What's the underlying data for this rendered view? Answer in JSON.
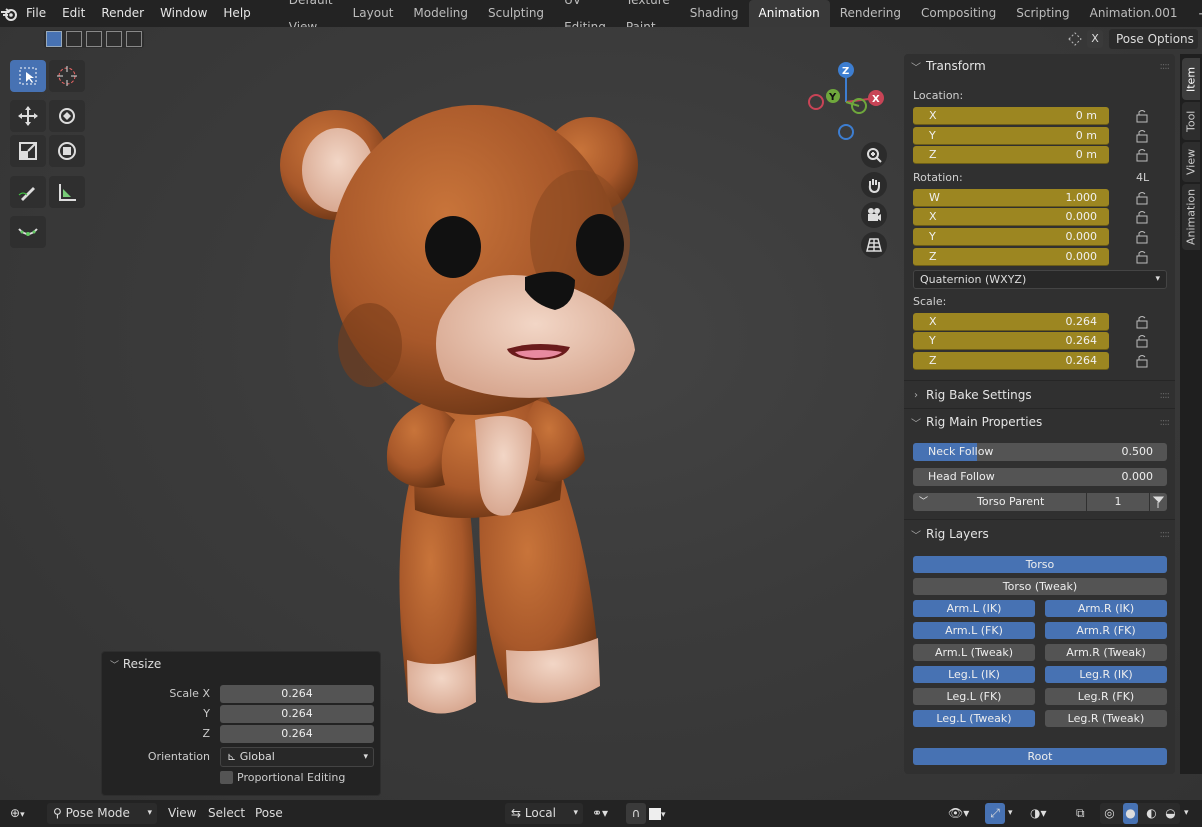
{
  "menu": {
    "items": [
      "File",
      "Edit",
      "Render",
      "Window",
      "Help"
    ]
  },
  "workspaces": {
    "tabs": [
      "Default View",
      "Layout",
      "Modeling",
      "Sculpting",
      "UV Editing",
      "Texture Paint",
      "Shading",
      "Animation",
      "Rendering",
      "Compositing",
      "Scripting",
      "Animation.001"
    ],
    "active": "Animation"
  },
  "header_right": {
    "x_label": "X",
    "pose_options": "Pose Options"
  },
  "gizmo": {
    "z": "Z",
    "y": "Y",
    "x": "X"
  },
  "npanel": {
    "transform": {
      "title": "Transform",
      "location_label": "Location:",
      "location": [
        {
          "axis": "X",
          "value": "0 m"
        },
        {
          "axis": "Y",
          "value": "0 m"
        },
        {
          "axis": "Z",
          "value": "0 m"
        }
      ],
      "rotation_label": "Rotation:",
      "rotation_4l": "4L",
      "rotation": [
        {
          "axis": "W",
          "value": "1.000"
        },
        {
          "axis": "X",
          "value": "0.000"
        },
        {
          "axis": "Y",
          "value": "0.000"
        },
        {
          "axis": "Z",
          "value": "0.000"
        }
      ],
      "rotation_mode": "Quaternion (WXYZ)",
      "scale_label": "Scale:",
      "scale": [
        {
          "axis": "X",
          "value": "0.264"
        },
        {
          "axis": "Y",
          "value": "0.264"
        },
        {
          "axis": "Z",
          "value": "0.264"
        }
      ]
    },
    "rig_bake": {
      "title": "Rig Bake Settings"
    },
    "rig_main": {
      "title": "Rig Main Properties",
      "neck_follow": {
        "label": "Neck Follow",
        "value": "0.500",
        "fraction": 0.5
      },
      "head_follow": {
        "label": "Head Follow",
        "value": "0.000",
        "fraction": 0
      },
      "torso_parent": {
        "label": "Torso Parent",
        "value": "1"
      }
    },
    "rig_layers": {
      "title": "Rig Layers",
      "torso": "Torso",
      "torso_tweak": "Torso (Tweak)",
      "rows": [
        [
          {
            "label": "Arm.L (IK)",
            "on": true
          },
          {
            "label": "Arm.R (IK)",
            "on": true
          }
        ],
        [
          {
            "label": "Arm.L (FK)",
            "on": true
          },
          {
            "label": "Arm.R (FK)",
            "on": true
          }
        ],
        [
          {
            "label": "Arm.L (Tweak)",
            "on": false
          },
          {
            "label": "Arm.R (Tweak)",
            "on": false
          }
        ],
        [
          {
            "label": "Leg.L (IK)",
            "on": true
          },
          {
            "label": "Leg.R (IK)",
            "on": true
          }
        ],
        [
          {
            "label": "Leg.L (FK)",
            "on": false
          },
          {
            "label": "Leg.R (FK)",
            "on": false
          }
        ],
        [
          {
            "label": "Leg.L (Tweak)",
            "on": true
          },
          {
            "label": "Leg.R (Tweak)",
            "on": false
          }
        ]
      ],
      "root": "Root"
    }
  },
  "side_tabs": [
    "Item",
    "Tool",
    "View",
    "Animation"
  ],
  "resize_panel": {
    "title": "Resize",
    "scale_x_label": "Scale X",
    "scale_x": "0.264",
    "y_label": "Y",
    "y": "0.264",
    "z_label": "Z",
    "z": "0.264",
    "orientation_label": "Orientation",
    "orientation": "Global",
    "proportional": "Proportional Editing"
  },
  "bottom": {
    "mode": "Pose Mode",
    "view": "View",
    "select": "Select",
    "pose": "Pose",
    "pivot": "Local"
  },
  "colors": {
    "accent": "#4772b3",
    "transform_field": "#9c8621"
  }
}
